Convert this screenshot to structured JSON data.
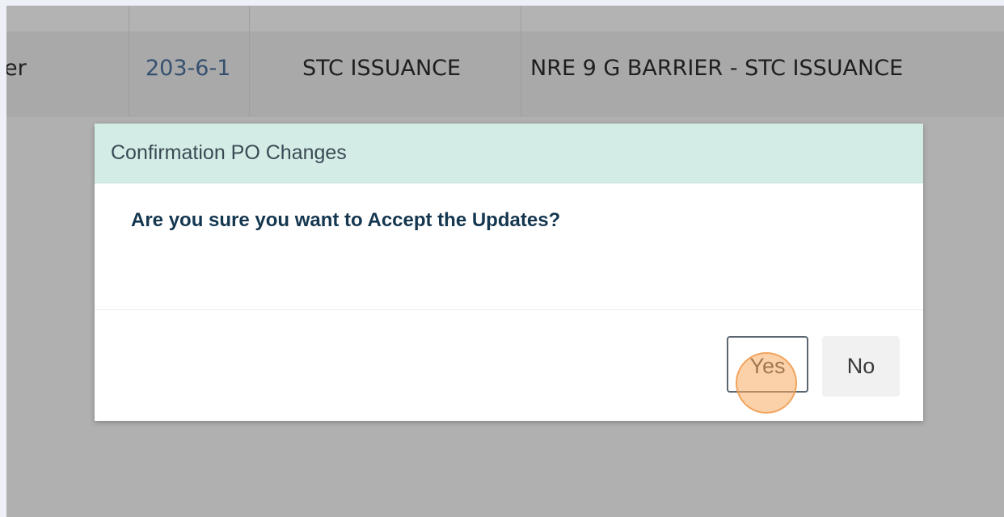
{
  "table": {
    "row": {
      "col1_fragment": "er",
      "col2_number": "203-6-1",
      "col3_type": "STC ISSUANCE",
      "col4_description": "NRE 9 G BARRIER - STC ISSUANCE"
    }
  },
  "dialog": {
    "title": "Confirmation PO Changes",
    "message": "Are you sure you want to Accept the Updates?",
    "yes_label": "Yes",
    "no_label": "No"
  },
  "colors": {
    "overlay": "#b0b0b0",
    "dialog_header": "#d3ede6",
    "message_text": "#14364f",
    "link_text": "#35506f",
    "click_marker": "#f8ac62"
  }
}
